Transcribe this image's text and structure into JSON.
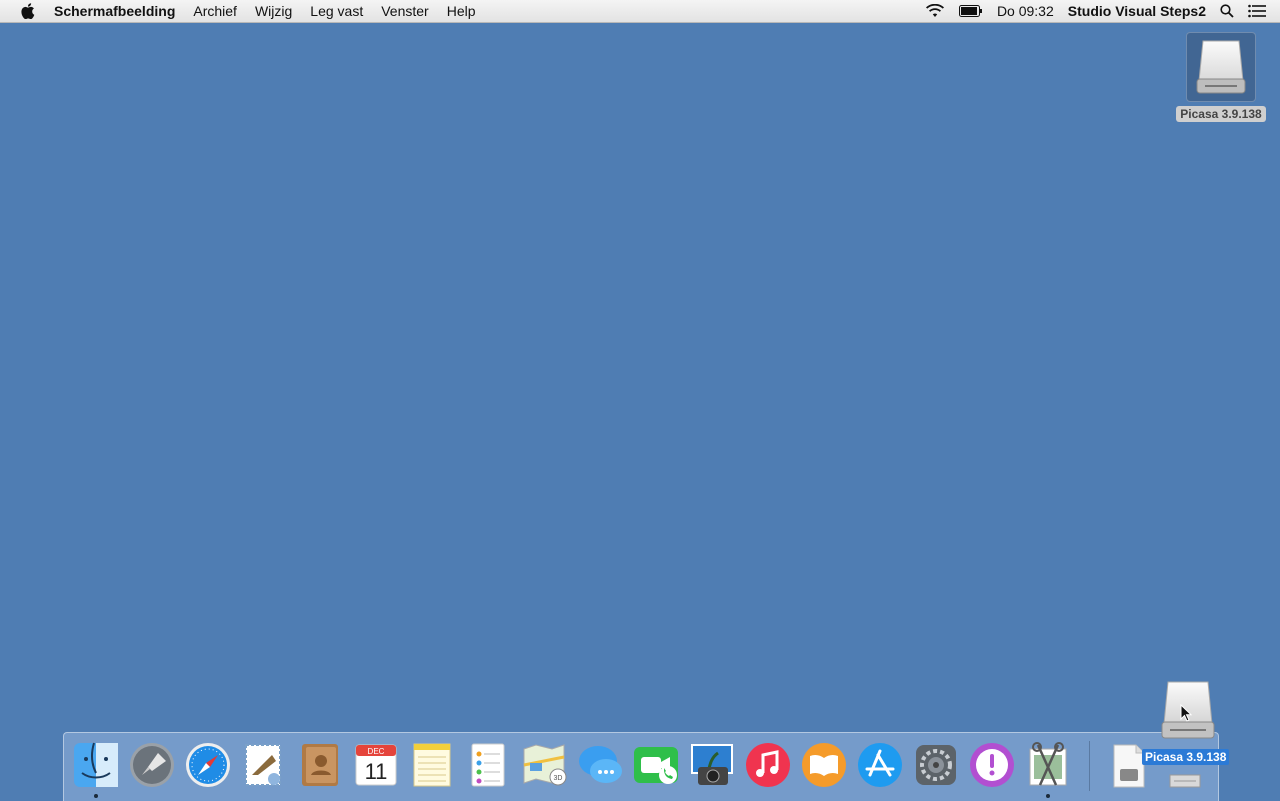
{
  "menubar": {
    "app_name": "Schermafbeelding",
    "menus": [
      "Archief",
      "Wijzig",
      "Leg vast",
      "Venster",
      "Help"
    ],
    "clock": "Do 09:32",
    "user": "Studio Visual Steps2",
    "icons": [
      "apple-icon",
      "wifi-icon",
      "battery-icon",
      "spotlight-search-icon",
      "notification-center-icon"
    ]
  },
  "desktop": {
    "drive_label": "Picasa 3.9.138",
    "drive_icon": "external-drive-icon"
  },
  "dock": {
    "apps": [
      {
        "name": "finder-icon",
        "running": true
      },
      {
        "name": "launchpad-icon",
        "running": false
      },
      {
        "name": "safari-icon",
        "running": false
      },
      {
        "name": "mail-icon",
        "running": false
      },
      {
        "name": "contacts-icon",
        "running": false
      },
      {
        "name": "calendar-icon",
        "running": false,
        "month": "DEC",
        "day": "11"
      },
      {
        "name": "notes-icon",
        "running": false
      },
      {
        "name": "reminders-icon",
        "running": false
      },
      {
        "name": "maps-icon",
        "running": false
      },
      {
        "name": "messages-icon",
        "running": false
      },
      {
        "name": "facetime-icon",
        "running": false
      },
      {
        "name": "iphoto-icon",
        "running": false
      },
      {
        "name": "itunes-icon",
        "running": false
      },
      {
        "name": "ibooks-icon",
        "running": false
      },
      {
        "name": "app-store-icon",
        "running": false
      },
      {
        "name": "system-preferences-icon",
        "running": false
      },
      {
        "name": "feedback-assistant-icon",
        "running": false
      },
      {
        "name": "screenshot-utility-icon",
        "running": true
      }
    ],
    "right_items": [
      "document-icon",
      "trash-icon"
    ]
  },
  "drag": {
    "label": "Picasa 3.9.138",
    "icon": "external-drive-icon"
  },
  "colors": {
    "desktop": "#4f7db3",
    "selection": "#2b7ad6"
  }
}
